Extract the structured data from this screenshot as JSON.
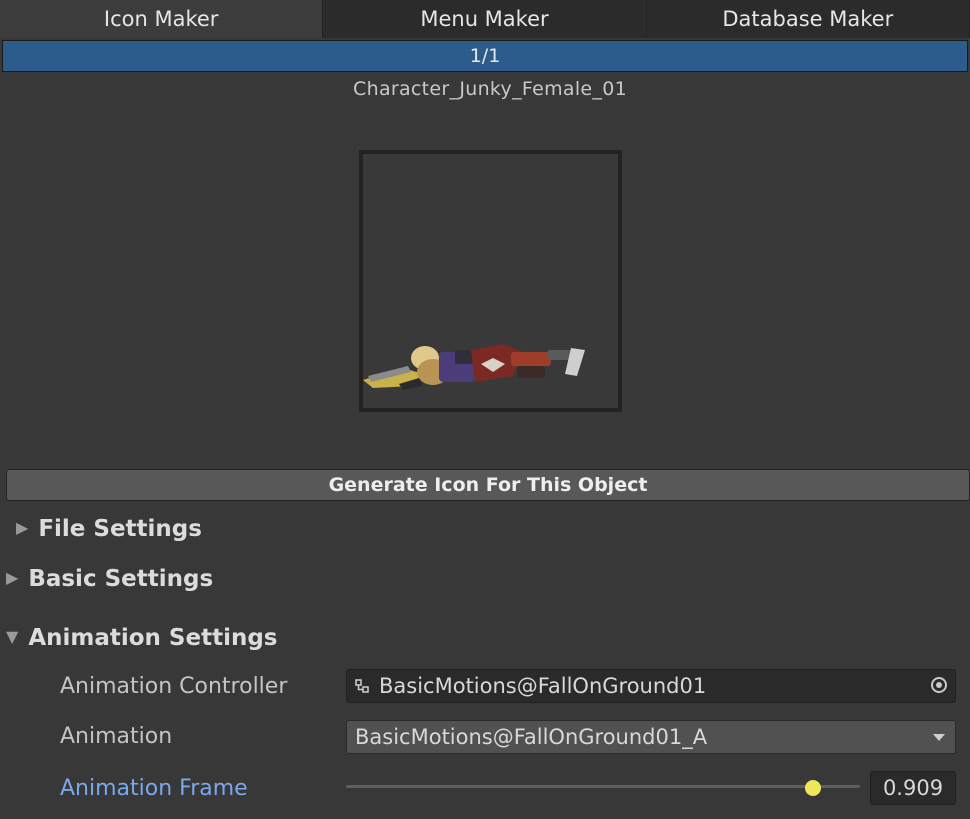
{
  "tabs": [
    {
      "label": "Icon Maker",
      "active": true
    },
    {
      "label": "Menu Maker",
      "active": false
    },
    {
      "label": "Database Maker",
      "active": false
    }
  ],
  "progress": {
    "text": "1/1",
    "fraction": 1.0
  },
  "object_name": "Character_Junky_Female_01",
  "generate_button": "Generate Icon For This Object",
  "sections": {
    "file": {
      "title": "File Settings",
      "expanded": false
    },
    "basic": {
      "title": "Basic Settings",
      "expanded": false
    },
    "animation": {
      "title": "Animation Settings",
      "expanded": true
    }
  },
  "animation_settings": {
    "controller_label": "Animation Controller",
    "controller_value": "BasicMotions@FallOnGround01",
    "animation_label": "Animation",
    "animation_value": "BasicMotions@FallOnGround01_A",
    "frame_label": "Animation Frame",
    "frame_value": "0.909",
    "frame_fraction": 0.909
  },
  "colors": {
    "accent": "#2b5c8b",
    "highlight_label": "#7ba7ec"
  }
}
